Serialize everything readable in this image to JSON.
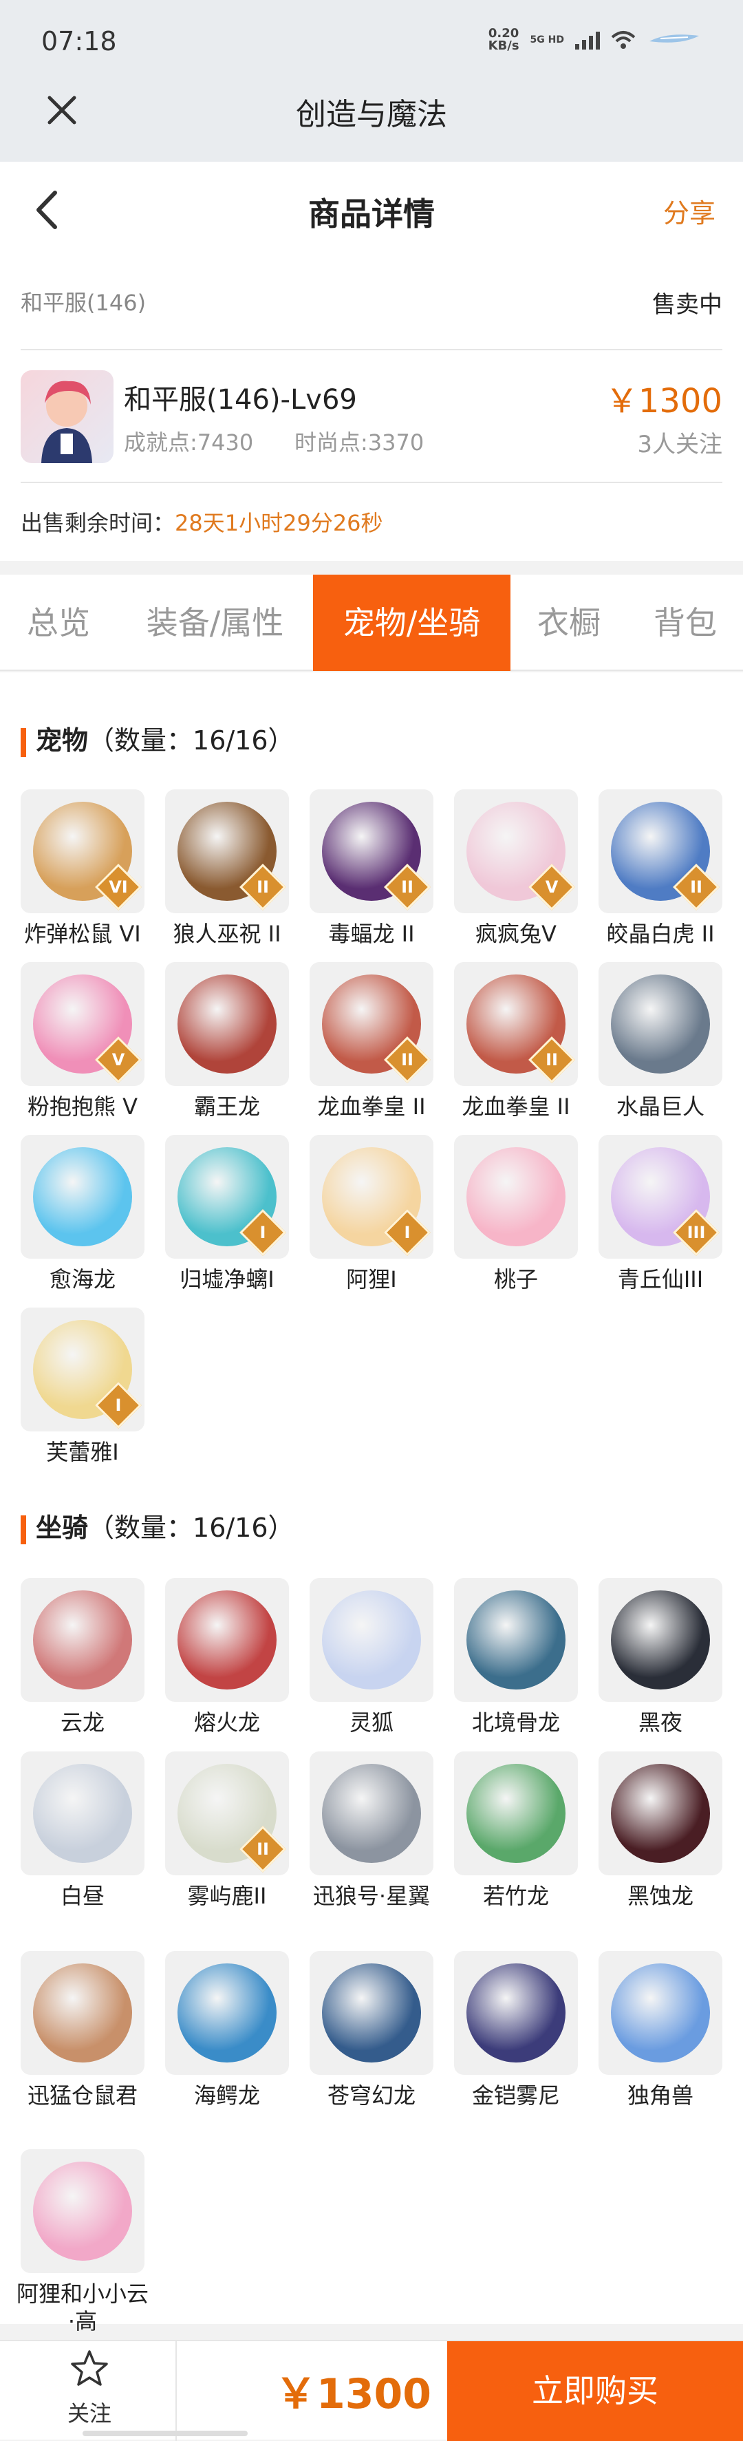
{
  "status": {
    "time": "07:18",
    "net_speed": "0.20",
    "net_unit": "KB/s",
    "net_type": "5G HD"
  },
  "app": {
    "title": "创造与魔法"
  },
  "header": {
    "title": "商品详情",
    "share_label": "分享"
  },
  "listing": {
    "server": "和平服(146)",
    "status": "售卖中",
    "character_name": "和平服(146)-Lv69",
    "achievement": "成就点:7430",
    "fashion": "时尚点:3370",
    "price": "￥1300",
    "followers": "3人关注",
    "remaining_label": "出售剩余时间：",
    "remaining_value": "28天1小时29分26秒"
  },
  "tabs": [
    "总览",
    "装备/属性",
    "宠物/坐骑",
    "衣橱",
    "背包"
  ],
  "active_tab": "宠物/坐骑",
  "pets": {
    "label": "宠物",
    "count": "（数量：16/16）",
    "items": [
      {
        "name": "炸弹松鼠 VI",
        "color": "#d7a05a",
        "badge": "VI"
      },
      {
        "name": "狼人巫祝 II",
        "color": "#8a5a30",
        "badge": "II"
      },
      {
        "name": "毒蝠龙 II",
        "color": "#5a2e72",
        "badge": "II"
      },
      {
        "name": "疯疯兔Ⅴ",
        "color": "#f0c8d8",
        "badge": "V"
      },
      {
        "name": "皎晶白虎 II",
        "color": "#4f7cc4",
        "badge": "II"
      },
      {
        "name": "粉抱抱熊 Ⅴ",
        "color": "#f08fb8",
        "badge": "V"
      },
      {
        "name": "霸王龙",
        "color": "#b0443a",
        "badge": ""
      },
      {
        "name": "龙血拳皇 II",
        "color": "#c25a48",
        "badge": "II"
      },
      {
        "name": "龙血拳皇 II",
        "color": "#c25a48",
        "badge": "II"
      },
      {
        "name": "水晶巨人",
        "color": "#6a7a8c",
        "badge": ""
      },
      {
        "name": "愈海龙",
        "color": "#5cc4ee",
        "badge": ""
      },
      {
        "name": "归墟净螭I",
        "color": "#4cc0cc",
        "badge": "I"
      },
      {
        "name": "阿狸I",
        "color": "#f5d5a0",
        "badge": "I"
      },
      {
        "name": "桃子",
        "color": "#f7b5c8",
        "badge": ""
      },
      {
        "name": "青丘仙III",
        "color": "#d7b8ee",
        "badge": "III"
      },
      {
        "name": "芙蕾雅I",
        "color": "#f0d890",
        "badge": "I"
      }
    ]
  },
  "mounts": {
    "label": "坐骑",
    "count": "（数量：16/16）",
    "items": [
      {
        "name": "云龙",
        "color": "#d07878",
        "badge": ""
      },
      {
        "name": "熔火龙",
        "color": "#c24444",
        "badge": ""
      },
      {
        "name": "灵狐",
        "color": "#c8d4f0",
        "badge": ""
      },
      {
        "name": "北境骨龙",
        "color": "#3c6e8c",
        "badge": ""
      },
      {
        "name": "黑夜",
        "color": "#2a2e38",
        "badge": ""
      },
      {
        "name": "白昼",
        "color": "#c8d0dc",
        "badge": ""
      },
      {
        "name": "雾屿鹿II",
        "color": "#d8dccc",
        "badge": "II"
      },
      {
        "name": "迅狼号·星翼",
        "color": "#8c94a0",
        "badge": ""
      },
      {
        "name": "若竹龙",
        "color": "#5aa86a",
        "badge": ""
      },
      {
        "name": "黑蚀龙",
        "color": "#4a1e24",
        "badge": ""
      },
      {
        "name": "迅猛仓鼠君",
        "color": "#c8906a",
        "badge": ""
      },
      {
        "name": "海鳄龙",
        "color": "#3a8cc8",
        "badge": ""
      },
      {
        "name": "苍穹幻龙",
        "color": "#345c8c",
        "badge": ""
      },
      {
        "name": "金铠雾尼",
        "color": "#3c3c7a",
        "badge": ""
      },
      {
        "name": "独角兽",
        "color": "#6a9ce0",
        "badge": ""
      },
      {
        "name": "阿狸和小小云·高",
        "color": "#f2a8c8",
        "badge": ""
      }
    ]
  },
  "bottom": {
    "follow_label": "关注",
    "price": "￥1300",
    "buy_label": "立即购买"
  }
}
